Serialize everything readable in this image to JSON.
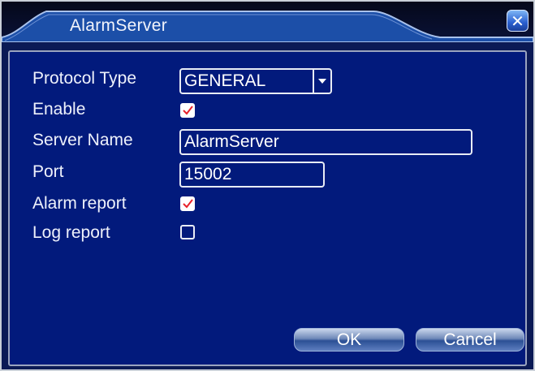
{
  "window": {
    "title": "AlarmServer"
  },
  "form": {
    "protocol_type_label": "Protocol Type",
    "protocol_type_value": "GENERAL",
    "enable_label": "Enable",
    "enable_checked": true,
    "server_name_label": "Server Name",
    "server_name_value": "AlarmServer",
    "port_label": "Port",
    "port_value": "15002",
    "alarm_report_label": "Alarm report",
    "alarm_report_checked": true,
    "log_report_label": "Log report",
    "log_report_checked": false
  },
  "buttons": {
    "ok_label": "OK",
    "cancel_label": "Cancel"
  },
  "colors": {
    "panel_background": "#021a7c",
    "check_mark": "#e8202a",
    "text": "#eef1fb"
  }
}
